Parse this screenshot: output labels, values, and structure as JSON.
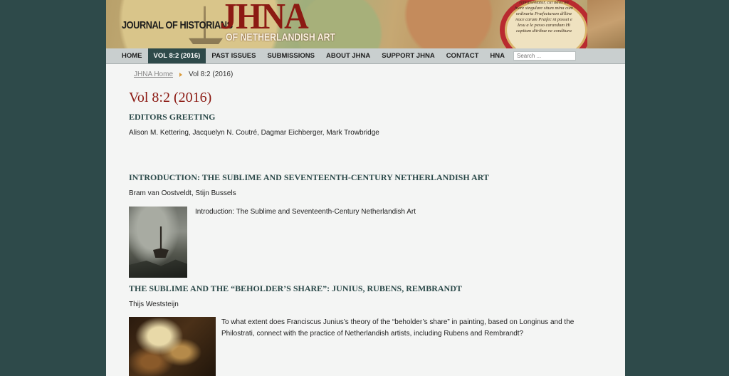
{
  "banner": {
    "journal_of": "JOURNAL OF HISTORIANS",
    "jhna": "JHNA",
    "netherlandish": "OF NETHERLANDISH ART",
    "cartouche_text": "repræsentatur, cui adiis aa fuere singulare situm mina cum ordinaria Præfecturam dilline noce carum Præfec ni posset e Iesu a le pesso carandum Hi capitum diiribue ne conditura"
  },
  "nav": {
    "items": [
      "HOME",
      "VOL 8:2 (2016)",
      "PAST ISSUES",
      "SUBMISSIONS",
      "ABOUT JHNA",
      "SUPPORT JHNA",
      "CONTACT",
      "HNA"
    ],
    "active_index": 1,
    "search_placeholder": "Search ..."
  },
  "breadcrumb": {
    "home": "JHNA Home",
    "current": "Vol 8:2 (2016)"
  },
  "page_title": "Vol 8:2 (2016)",
  "sections": [
    {
      "title": "EDITORS GREETING",
      "authors": "Alison M. Kettering, Jacquelyn N. Coutré, Dagmar Eichberger, Mark Trowbridge"
    },
    {
      "title": "INTRODUCTION: THE SUBLIME AND SEVENTEENTH-CENTURY NETHERLANDISH ART",
      "authors": "Bram van Oostveldt, Stijn Bussels",
      "abstract": "Introduction: The Sublime and Seventeenth-Century Netherlandish Art"
    },
    {
      "title": "THE SUBLIME AND THE “BEHOLDER’S SHARE”: JUNIUS, RUBENS, REMBRANDT",
      "authors": "Thijs Weststeijn",
      "abstract": "To what extent does Franciscus Junius’s theory of the “beholder’s share” in painting, based on Longinus and the Philostrati, connect with the practice of Netherlandish artists, including Rubens and Rembrandt?"
    }
  ],
  "colors": {
    "background": "#2e4a4a",
    "title_red": "#8c1a13",
    "section_teal": "#2c4a4a",
    "nav_active": "#2e4a4a",
    "breadcrumb_arrow": "#d99a3a"
  }
}
